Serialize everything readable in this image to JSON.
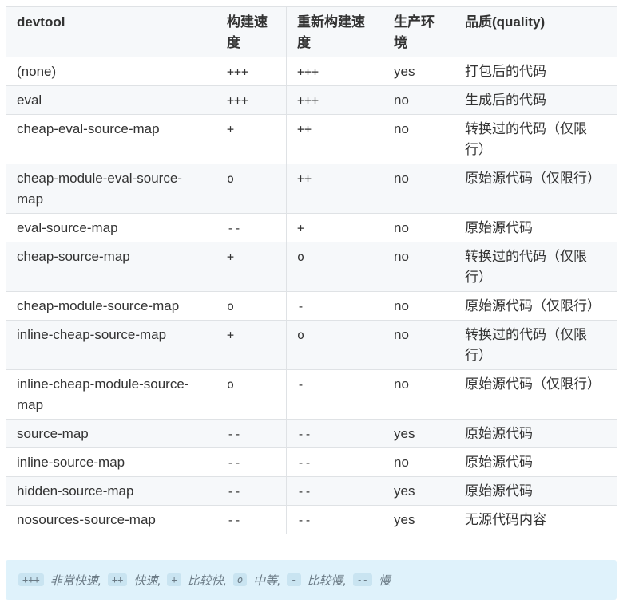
{
  "table": {
    "headers": [
      "devtool",
      "构建速度",
      "重新构建速度",
      "生产环境",
      "品质(quality)"
    ],
    "rows": [
      [
        "(none)",
        "+++",
        "+++",
        "yes",
        "打包后的代码"
      ],
      [
        "eval",
        "+++",
        "+++",
        "no",
        "生成后的代码"
      ],
      [
        "cheap-eval-source-map",
        "+",
        "++",
        "no",
        "转换过的代码（仅限行）"
      ],
      [
        "cheap-module-eval-source-map",
        "o",
        "++",
        "no",
        "原始源代码（仅限行）"
      ],
      [
        "eval-source-map",
        "--",
        "+",
        "no",
        "原始源代码"
      ],
      [
        "cheap-source-map",
        "+",
        "o",
        "no",
        "转换过的代码（仅限行）"
      ],
      [
        "cheap-module-source-map",
        "o",
        "-",
        "no",
        "原始源代码（仅限行）"
      ],
      [
        "inline-cheap-source-map",
        "+",
        "o",
        "no",
        "转换过的代码（仅限行）"
      ],
      [
        "inline-cheap-module-source-map",
        "o",
        "-",
        "no",
        "原始源代码（仅限行）"
      ],
      [
        "source-map",
        "--",
        "--",
        "yes",
        "原始源代码"
      ],
      [
        "inline-source-map",
        "--",
        "--",
        "no",
        "原始源代码"
      ],
      [
        "hidden-source-map",
        "--",
        "--",
        "yes",
        "原始源代码"
      ],
      [
        "nosources-source-map",
        "--",
        "--",
        "yes",
        "无源代码内容"
      ]
    ]
  },
  "legend": {
    "items": [
      {
        "code": "+++",
        "desc": "非常快速,"
      },
      {
        "code": "++",
        "desc": "快速,"
      },
      {
        "code": "+",
        "desc": "比较快,"
      },
      {
        "code": "o",
        "desc": "中等,"
      },
      {
        "code": "-",
        "desc": "比较慢,"
      },
      {
        "code": "--",
        "desc": "慢"
      }
    ]
  }
}
